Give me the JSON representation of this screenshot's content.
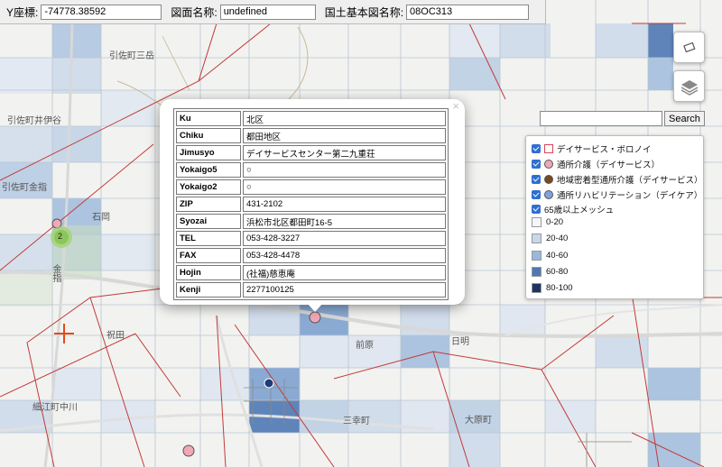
{
  "coordbar": {
    "y_label": "Y座標:",
    "y_value": "-74778.38592",
    "map_name_label": "図面名称:",
    "map_name_value": "undefined",
    "base_map_label": "国土基本図名称:",
    "base_map_value": "08OC313"
  },
  "search": {
    "button_label": "Search",
    "value": ""
  },
  "controls": {
    "ruler_icon": "ruler-icon",
    "layers_icon": "layers-icon"
  },
  "legend": {
    "items": [
      {
        "label": "デイサービス・ボロノイ",
        "symbol": "square-outline-red",
        "checked": true
      },
      {
        "label": "通所介護（デイサービス）",
        "symbol": "circle-pink",
        "checked": true
      },
      {
        "label": "地域密着型通所介護（デイサービス）",
        "symbol": "circle-brown",
        "checked": true
      },
      {
        "label": "通所リハビリテーション（デイケア）",
        "symbol": "circle-blue",
        "checked": true
      },
      {
        "label": "65歳以上メッシュ",
        "checked": true
      }
    ],
    "classes": [
      {
        "label": "0-20",
        "color": "#f4f6fa"
      },
      {
        "label": "20-40",
        "color": "#c9d7ea"
      },
      {
        "label": "40-60",
        "color": "#9ab8db"
      },
      {
        "label": "60-80",
        "color": "#4e78b4"
      },
      {
        "label": "80-100",
        "color": "#1b3560"
      }
    ]
  },
  "popup": {
    "close": "×",
    "rows": [
      {
        "key": "Ku",
        "value": "北区"
      },
      {
        "key": "Chiku",
        "value": "都田地区"
      },
      {
        "key": "Jimusyo",
        "value": "デイサービスセンター第二九重荘"
      },
      {
        "key": "Yokaigo5",
        "value": "○"
      },
      {
        "key": "Yokaigo2",
        "value": "○"
      },
      {
        "key": "ZIP",
        "value": "431-2102"
      },
      {
        "key": "Syozai",
        "value": "浜松市北区都田町16-5"
      },
      {
        "key": "TEL",
        "value": "053-428-3227"
      },
      {
        "key": "FAX",
        "value": "053-428-4478"
      },
      {
        "key": "Hojin",
        "value": "(社福)慈恵庵"
      },
      {
        "key": "Kenji",
        "value": "2277100125"
      }
    ]
  },
  "map": {
    "labels": [
      "引佐町三岳",
      "引佐町井伊谷",
      "引佐町金指",
      "石岡",
      "祝田",
      "細江町中川",
      "前原",
      "三幸町",
      "大原町",
      "日明",
      "金指"
    ],
    "cluster_count": "2"
  }
}
